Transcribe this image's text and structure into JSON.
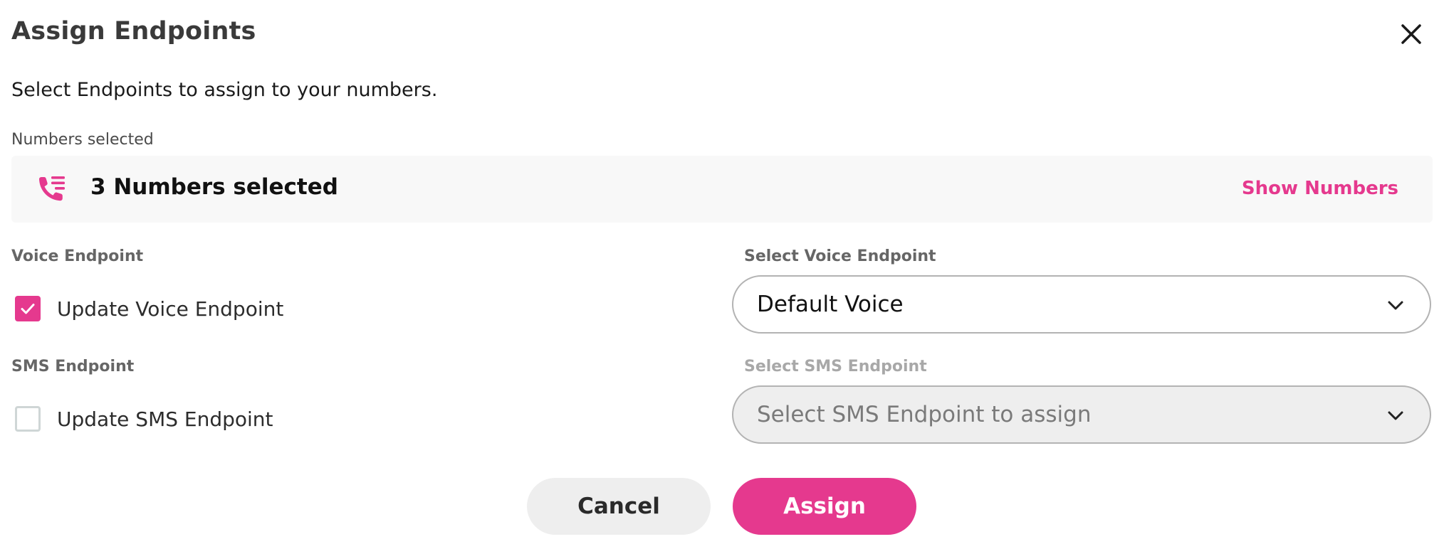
{
  "dialog": {
    "title": "Assign Endpoints",
    "subtitle": "Select Endpoints to assign to your numbers."
  },
  "numbers": {
    "label": "Numbers selected",
    "summary": "3 Numbers selected",
    "show_link": "Show Numbers",
    "icon": "phone-list-icon"
  },
  "voice": {
    "section_label": "Voice Endpoint",
    "checkbox_label": "Update Voice Endpoint",
    "checked": true,
    "select_label": "Select Voice Endpoint",
    "select_value": "Default Voice"
  },
  "sms": {
    "section_label": "SMS Endpoint",
    "checkbox_label": "Update SMS Endpoint",
    "checked": false,
    "select_label": "Select SMS Endpoint",
    "select_placeholder": "Select SMS Endpoint to assign",
    "disabled": true
  },
  "actions": {
    "cancel": "Cancel",
    "assign": "Assign"
  },
  "colors": {
    "accent": "#e5398e",
    "muted_label": "#666666",
    "disabled_text": "#a8a8a8"
  }
}
